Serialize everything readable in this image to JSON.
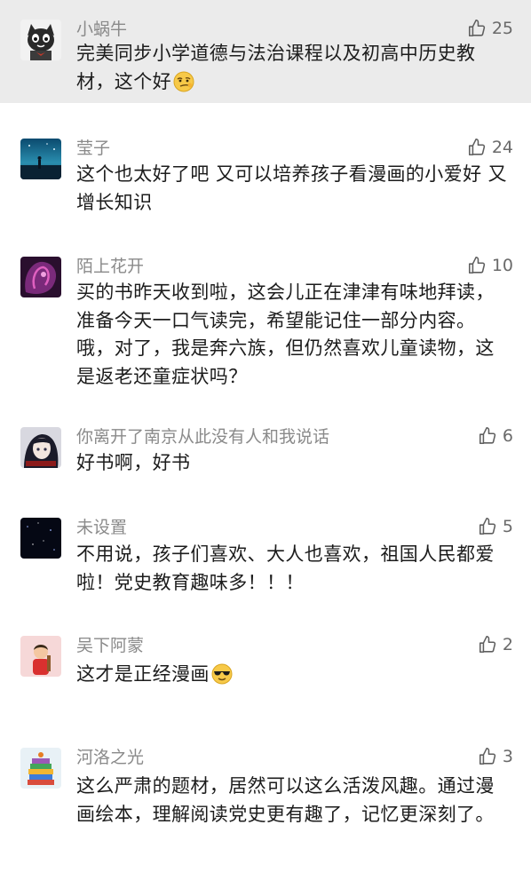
{
  "comments": [
    {
      "username": "小蜗牛",
      "likes": "25",
      "text": "完美同步小学道德与法治课程以及初高中历史教材，这个好",
      "avatar": "cat-avatar-icon",
      "emoji": "smirk-emoji-icon"
    },
    {
      "username": "莹子",
      "likes": "24",
      "text": "这个也太好了吧  又可以培养孩子看漫画的小爱好  又增长知识",
      "avatar": "night-scene-avatar-icon"
    },
    {
      "username": "陌上花开",
      "likes": "10",
      "text": "买的书昨天收到啦，这会儿正在津津有味地拜读，准备今天一口气读完，希望能记住一部分内容。哦，对了，我是奔六族，但仍然喜欢儿童读物，这是返老还童症状吗？",
      "avatar": "purple-portrait-avatar-icon"
    },
    {
      "username": "你离开了南京从此没有人和我说话",
      "likes": "6",
      "text": "好书啊，好书",
      "avatar": "anime-avatar-icon"
    },
    {
      "username": "未设置",
      "likes": "5",
      "text": "不用说，孩子们喜欢、大人也喜欢，祖国人民都爱啦！党史教育趣味多！！！",
      "avatar": "starry-sky-avatar-icon"
    },
    {
      "username": "吴下阿蒙",
      "likes": "2",
      "text": "这才是正经漫画",
      "avatar": "cartoon-avatar-icon",
      "emoji": "sunglasses-emoji-icon"
    },
    {
      "username": "河洛之光",
      "likes": "3",
      "text": "这么严肃的题材，居然可以这么活泼风趣。通过漫画绘本，理解阅读党史更有趣了，记忆更深刻了。",
      "avatar": "book-stack-avatar-icon"
    }
  ],
  "icons": {
    "like": "thumbs-up-icon"
  },
  "colors": {
    "highlight_background": "#ebebeb",
    "username": "#8a8a8a",
    "like_count": "#6a6a6a"
  }
}
